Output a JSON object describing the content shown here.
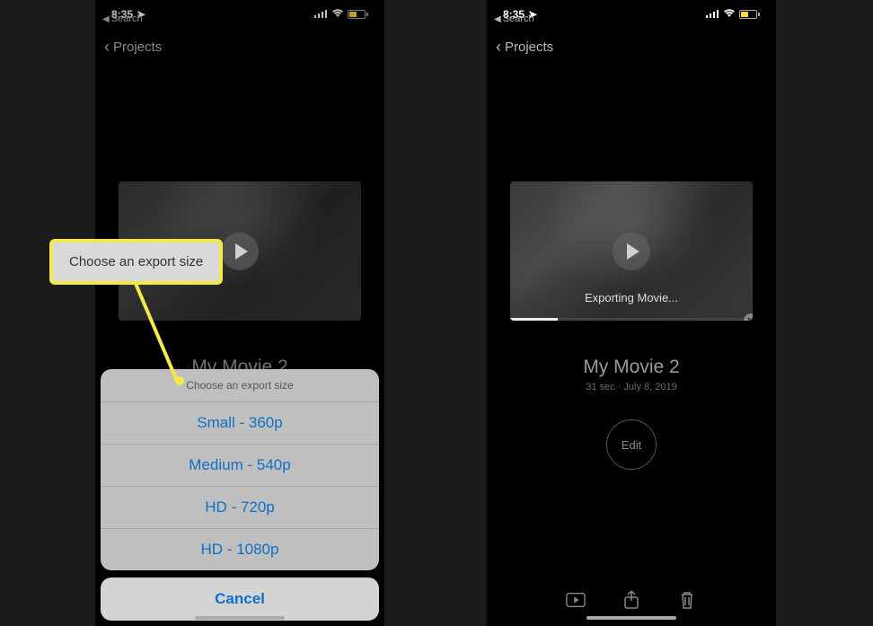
{
  "status": {
    "time": "8:35",
    "back_app": "Search"
  },
  "nav": {
    "back_label": "Projects"
  },
  "movie": {
    "title": "My Movie 2",
    "meta": "31 sec · July 8, 2019",
    "exporting": "Exporting Movie...",
    "edit_label": "Edit"
  },
  "sheet": {
    "header": "Choose an export size",
    "options": [
      "Small - 360p",
      "Medium - 540p",
      "HD - 720p",
      "HD - 1080p"
    ],
    "cancel": "Cancel"
  },
  "callout": {
    "text": "Choose an export size"
  }
}
